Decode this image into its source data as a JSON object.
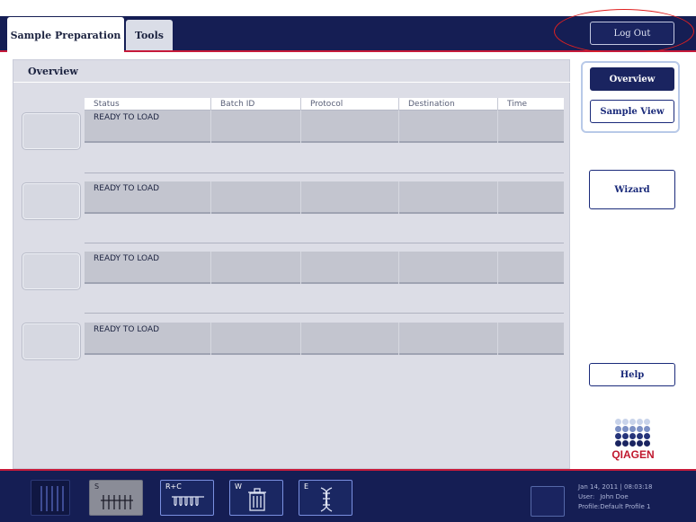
{
  "tabs": [
    {
      "label": "Sample Preparation",
      "active": true
    },
    {
      "label": "Tools",
      "active": false
    }
  ],
  "logout_label": "Log Out",
  "main": {
    "title": "Overview",
    "columns": [
      "Status",
      "Batch ID",
      "Protocol",
      "Destination",
      "Time"
    ],
    "rows": [
      {
        "status": "READY TO LOAD",
        "batch_id": "",
        "protocol": "",
        "destination": "",
        "time": ""
      },
      {
        "status": "READY TO LOAD",
        "batch_id": "",
        "protocol": "",
        "destination": "",
        "time": ""
      },
      {
        "status": "READY TO LOAD",
        "batch_id": "",
        "protocol": "",
        "destination": "",
        "time": ""
      },
      {
        "status": "READY TO LOAD",
        "batch_id": "",
        "protocol": "",
        "destination": "",
        "time": ""
      }
    ]
  },
  "sidebar": {
    "overview_label": "Overview",
    "sample_view_label": "Sample View",
    "wizard_label": "Wizard",
    "help_label": "Help",
    "logo_text": "QIAGEN"
  },
  "bottom": {
    "trays": [
      {
        "label": "",
        "icon": "tube-rack-icon"
      },
      {
        "label": "S",
        "icon": "sample-tubes-icon"
      },
      {
        "label": "R+C",
        "icon": "reagent-cartridge-icon"
      },
      {
        "label": "W",
        "icon": "waste-bin-icon"
      },
      {
        "label": "E",
        "icon": "elution-dna-icon"
      }
    ],
    "status": {
      "datetime": "Jan 14, 2011 | 08:03:18",
      "user_key": "User:",
      "user_value": "John Doe",
      "profile_key": "Profile:",
      "profile_value": "Default Profile 1"
    }
  },
  "colors": {
    "navy": "#151e54",
    "accent_red": "#c61a3a",
    "panel_grey": "#dcdde6",
    "logo_red": "#c0182e",
    "annotation_ring": "#e02020"
  }
}
